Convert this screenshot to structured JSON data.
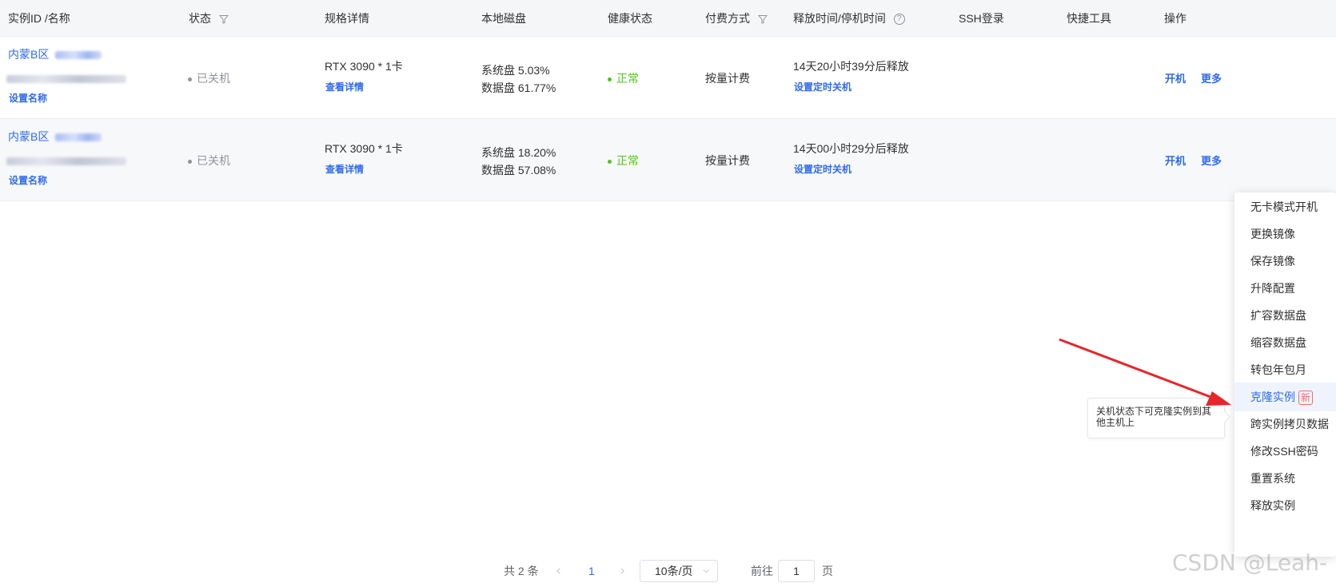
{
  "headers": {
    "instance": "实例ID /名称",
    "status": "状态",
    "spec": "规格详情",
    "disk": "本地磁盘",
    "health": "健康状态",
    "billing": "付费方式",
    "release": "释放时间/停机时间",
    "ssh": "SSH登录",
    "tools": "快捷工具",
    "ops": "操作"
  },
  "rows": [
    {
      "region": "内蒙B区",
      "set_name": "设置名称",
      "status": "已关机",
      "gpu": "RTX 3090 * 1卡",
      "view_detail": "查看详情",
      "sys_disk": "系统盘 5.03%",
      "data_disk": "数据盘 61.77%",
      "health": "正常",
      "billing": "按量计费",
      "release": "14天20小时39分后释放",
      "timer": "设置定时关机",
      "power_on": "开机",
      "more": "更多"
    },
    {
      "region": "内蒙B区",
      "set_name": "设置名称",
      "status": "已关机",
      "gpu": "RTX 3090 * 1卡",
      "view_detail": "查看详情",
      "sys_disk": "系统盘 18.20%",
      "data_disk": "数据盘 57.08%",
      "health": "正常",
      "billing": "按量计费",
      "release": "14天00小时29分后释放",
      "timer": "设置定时关机",
      "power_on": "开机",
      "more": "更多"
    }
  ],
  "menu": [
    "无卡模式开机",
    "更换镜像",
    "保存镜像",
    "升降配置",
    "扩容数据盘",
    "缩容数据盘",
    "转包年包月",
    "克隆实例",
    "跨实例拷贝数据",
    "修改SSH密码",
    "重置系统",
    "释放实例"
  ],
  "menu_new_badge": "新",
  "tooltip": "关机状态下可克隆实例到其他主机上",
  "pagination": {
    "total": "共 2 条",
    "current_page": "1",
    "page_size": "10条/页",
    "goto_label": "前往",
    "goto_value": "1",
    "page_unit": "页"
  },
  "watermark": "CSDN @Leah-",
  "colors": {
    "link": "#2f6bea",
    "success": "#52c41a",
    "annotation_arrow": "#e5262b",
    "badge": "#f56c6c"
  }
}
